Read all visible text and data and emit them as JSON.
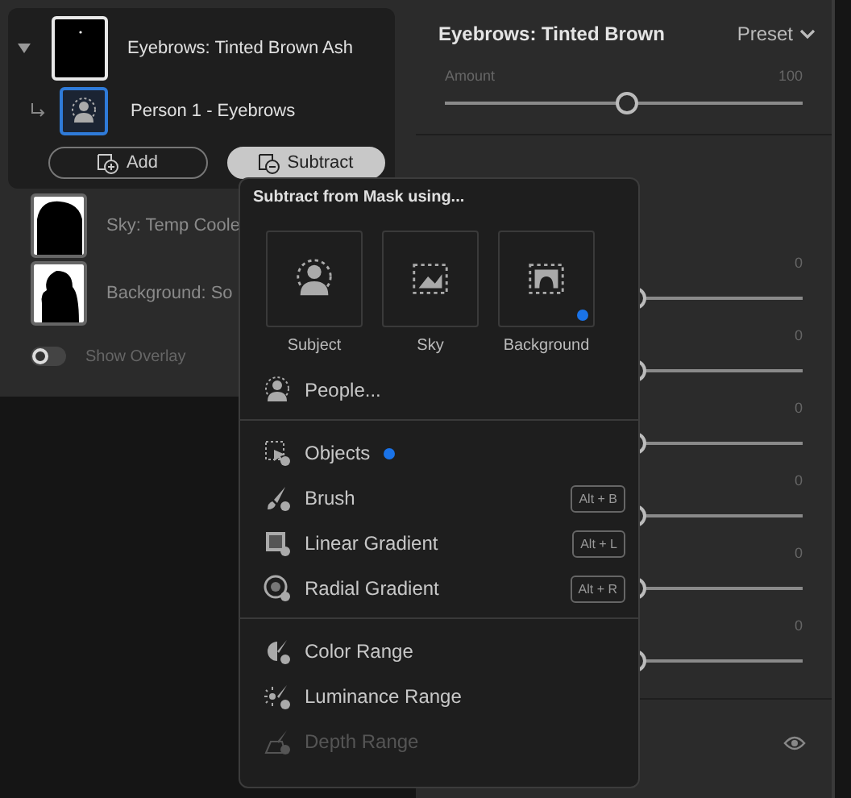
{
  "masks": {
    "items": [
      {
        "name": "Eyebrows: Tinted Brown Ash",
        "kind": "spot",
        "selected": true,
        "expanded": true,
        "children": [
          {
            "name": "Person 1 - Eyebrows",
            "selected": true
          }
        ]
      },
      {
        "name": "Sky: Temp Coole",
        "kind": "sky",
        "selected": false
      },
      {
        "name": "Background: So",
        "kind": "figure",
        "selected": false
      }
    ],
    "add_label": "Add",
    "subtract_label": "Subtract",
    "subtract_active": true,
    "overlay": {
      "label": "Show Overlay",
      "on": false
    }
  },
  "adjust": {
    "title": "Eyebrows: Tinted Brown",
    "preset": "Preset",
    "amount": {
      "label": "Amount",
      "value": "100",
      "level": 0.51
    },
    "sliders": [
      {
        "value": "0",
        "level": 0.53
      },
      {
        "value": "0",
        "level": 0.53
      },
      {
        "value": "0",
        "level": 0.53
      },
      {
        "value": "0",
        "level": 0.53
      },
      {
        "value": "0",
        "level": 0.53
      },
      {
        "value": "0",
        "level": 0.53
      }
    ]
  },
  "menu": {
    "title": "Subtract from Mask using...",
    "tiles": [
      {
        "label": "Subject",
        "kind": "subject",
        "badge": false
      },
      {
        "label": "Sky",
        "kind": "sky",
        "badge": false
      },
      {
        "label": "Background",
        "kind": "background",
        "badge": true
      }
    ],
    "groups": [
      [
        {
          "label": "People...",
          "kind": "people",
          "badge": false,
          "disabled": false
        }
      ],
      [
        {
          "label": "Objects",
          "kind": "objects",
          "badge": true,
          "disabled": false
        },
        {
          "label": "Brush",
          "kind": "brush",
          "shortcut": "Alt + B",
          "badge": false,
          "disabled": false
        },
        {
          "label": "Linear Gradient",
          "kind": "linear",
          "shortcut": "Alt + L",
          "badge": false,
          "disabled": false
        },
        {
          "label": "Radial Gradient",
          "kind": "radial",
          "shortcut": "Alt + R",
          "badge": false,
          "disabled": false
        }
      ],
      [
        {
          "label": "Color Range",
          "kind": "color",
          "badge": false,
          "disabled": false
        },
        {
          "label": "Luminance Range",
          "kind": "luminance",
          "badge": false,
          "disabled": false
        },
        {
          "label": "Depth Range",
          "kind": "depth",
          "badge": false,
          "disabled": true
        }
      ]
    ]
  }
}
